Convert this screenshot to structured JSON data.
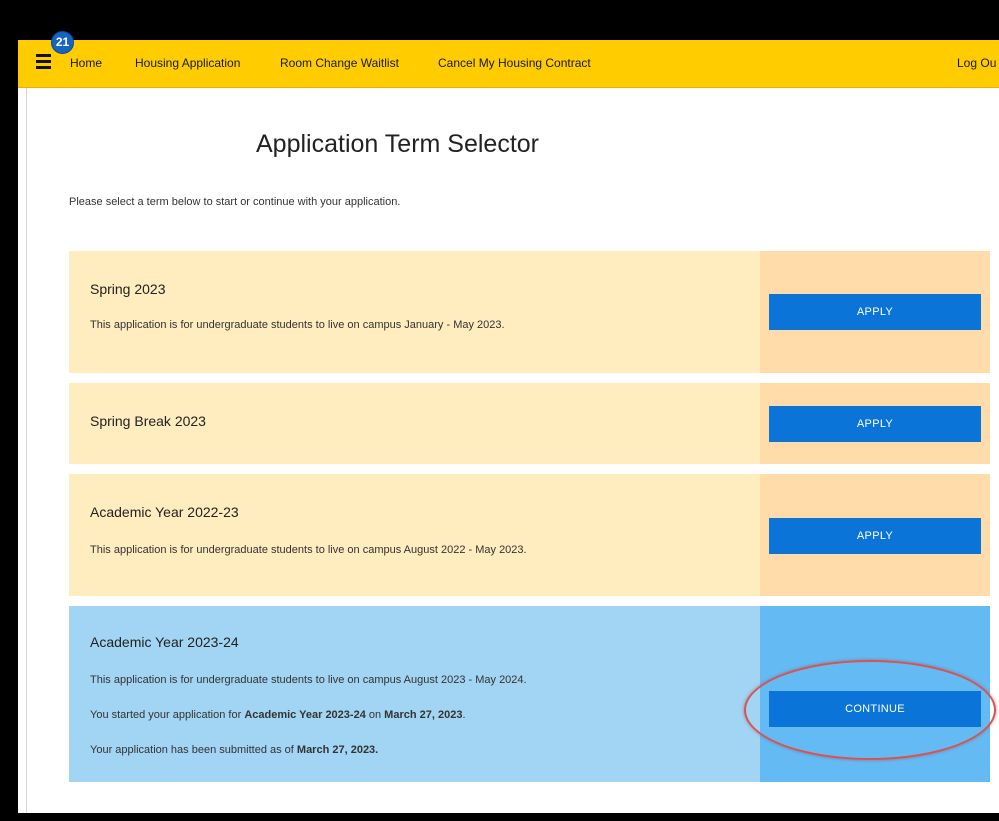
{
  "nav": {
    "badge_count": "21",
    "links": [
      "Home",
      "Housing Application",
      "Room Change Waitlist",
      "Cancel My Housing Contract"
    ],
    "logout": "Log Ou"
  },
  "page": {
    "title": "Application Term Selector",
    "instructions": "Please select a term below to start or continue with your application."
  },
  "terms": [
    {
      "name": "Spring 2023",
      "description": "This application is for undergraduate students to live on campus January - May 2023.",
      "button": "APPLY"
    },
    {
      "name": "Spring Break 2023",
      "button": "APPLY"
    },
    {
      "name": "Academic Year 2022-23",
      "description": "This application is for undergraduate students to live on campus August 2022 - May 2023.",
      "button": "APPLY"
    },
    {
      "name": "Academic Year 2023-24",
      "description": "This application is for undergraduate students to live on campus August 2023 - May 2024.",
      "started_prefix": "You started your application for ",
      "started_term": "Academic Year 2023-24",
      "started_mid": " on ",
      "started_date": "March 27, 2023",
      "started_suffix": ".",
      "submitted_prefix": "Your application has been submitted as of ",
      "submitted_date": "March 27, 2023.",
      "button": "CONTINUE"
    }
  ],
  "colors": {
    "nav_bg": "#ffcc00",
    "card_yellow": "#ffecbf",
    "card_yellow_side": "#ffdcaa",
    "card_blue": "#a2d4f4",
    "card_blue_side": "#64bbf3",
    "button": "#0a74d8",
    "highlight_circle": "#d9534f"
  }
}
